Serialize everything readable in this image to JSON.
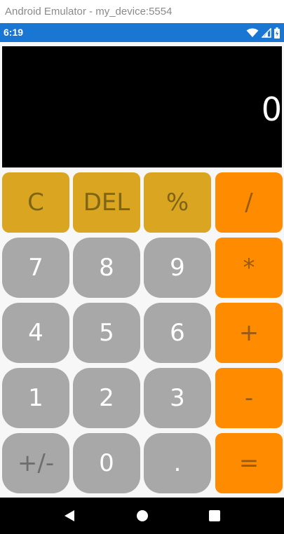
{
  "window": {
    "title": "Android Emulator - my_device:5554"
  },
  "status_bar": {
    "time": "6:19",
    "icons": [
      "wifi-icon",
      "signal-icon",
      "battery-icon"
    ],
    "color": "#1976d2"
  },
  "display": {
    "value": "0"
  },
  "keypad": {
    "rows": [
      [
        {
          "label": "C",
          "kind": "fn"
        },
        {
          "label": "DEL",
          "kind": "fn"
        },
        {
          "label": "%",
          "kind": "fn"
        },
        {
          "label": "/",
          "kind": "op"
        }
      ],
      [
        {
          "label": "7",
          "kind": "num"
        },
        {
          "label": "8",
          "kind": "num"
        },
        {
          "label": "9",
          "kind": "num"
        },
        {
          "label": "*",
          "kind": "op"
        }
      ],
      [
        {
          "label": "4",
          "kind": "num"
        },
        {
          "label": "5",
          "kind": "num"
        },
        {
          "label": "6",
          "kind": "num"
        },
        {
          "label": "+",
          "kind": "op"
        }
      ],
      [
        {
          "label": "1",
          "kind": "num"
        },
        {
          "label": "2",
          "kind": "num"
        },
        {
          "label": "3",
          "kind": "num"
        },
        {
          "label": "-",
          "kind": "op"
        }
      ],
      [
        {
          "label": "+/-",
          "kind": "num"
        },
        {
          "label": "0",
          "kind": "num"
        },
        {
          "label": ".",
          "kind": "num"
        },
        {
          "label": "=",
          "kind": "op"
        }
      ]
    ]
  },
  "colors": {
    "function_key": "#daa520",
    "operator_key": "#ff8c00",
    "number_key": "#a8a8a8",
    "display_background": "#000000"
  },
  "navigation_bar": {
    "buttons": [
      "back-icon",
      "home-icon",
      "recents-icon"
    ]
  }
}
